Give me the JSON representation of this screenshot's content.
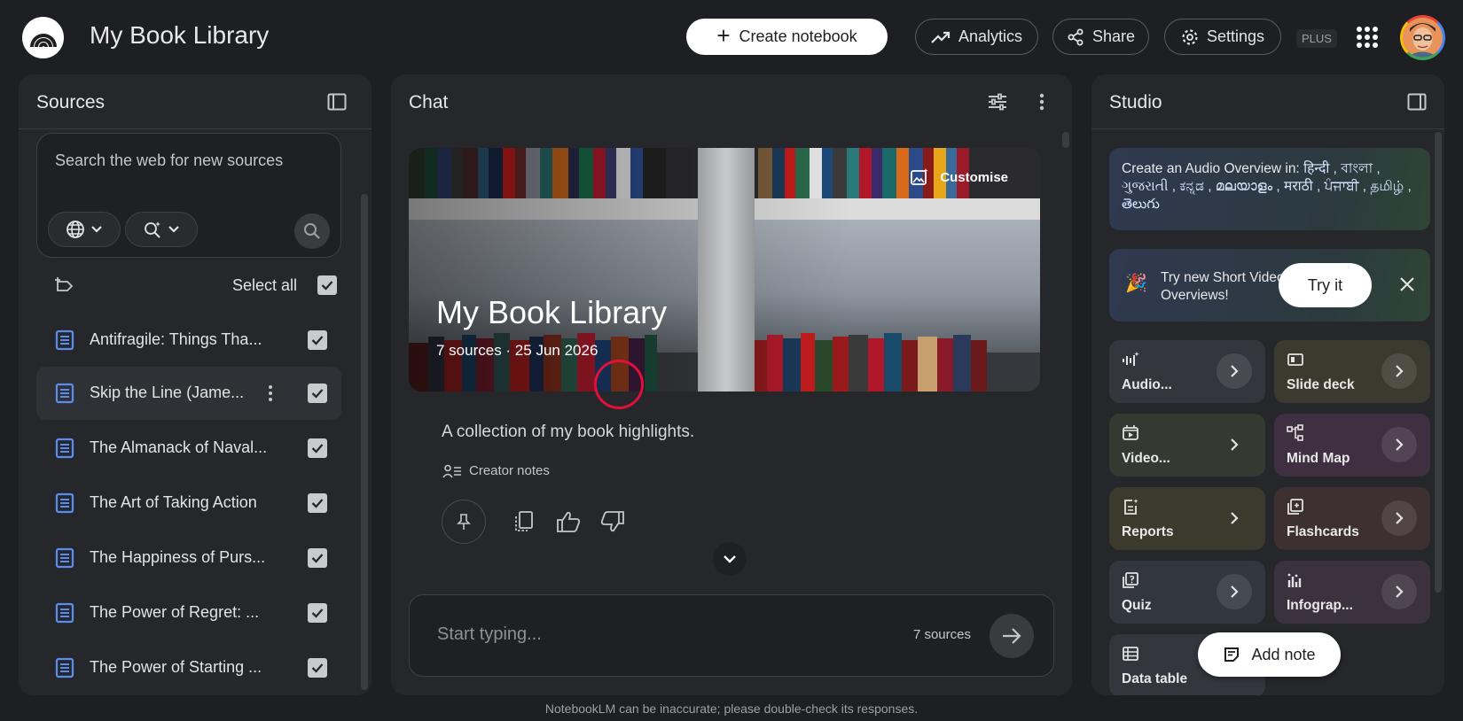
{
  "header": {
    "title": "My Book Library",
    "create_label": "Create notebook",
    "analytics_label": "Analytics",
    "share_label": "Share",
    "settings_label": "Settings",
    "plan_badge": "PLUS"
  },
  "sources": {
    "title": "Sources",
    "search_placeholder": "Search the web for new sources",
    "select_all_label": "Select all",
    "items": [
      {
        "label": "Antifragile: Things Tha...",
        "checked": true
      },
      {
        "label": "Skip the Line (Jame...",
        "checked": true
      },
      {
        "label": "The Almanack of Naval...",
        "checked": true
      },
      {
        "label": "The Art of Taking Action",
        "checked": true
      },
      {
        "label": "The Happiness of Purs...",
        "checked": true
      },
      {
        "label": "The Power of Regret: ...",
        "checked": true
      },
      {
        "label": "The Power of Starting ...",
        "checked": true
      }
    ]
  },
  "chat": {
    "title": "Chat",
    "hero_title": "My Book Library",
    "hero_meta": "7 sources · 25 Jun 2026",
    "customise_label": "Customise",
    "description": "A collection of my book highlights.",
    "creator_notes_label": "Creator notes",
    "input_placeholder": "Start typing...",
    "source_count": "7 sources"
  },
  "studio": {
    "title": "Studio",
    "audio_overview_prefix": "Create an Audio Overview in:",
    "audio_overview_languages": "हिन्दी , বাংলা , ગુજરાતી , ಕನ್ನಡ , മലയാളം , मराठी , ਪੰਜਾਬੀ , தமிழ் , తెలుగు",
    "promo_text": "Try new Short Video Overviews!",
    "try_label": "Try it",
    "tiles": [
      {
        "label": "Audio...",
        "icon": "audio-waveform-icon"
      },
      {
        "label": "Slide deck",
        "icon": "slides-icon"
      },
      {
        "label": "Video...",
        "icon": "video-icon"
      },
      {
        "label": "Mind Map",
        "icon": "mind-map-icon"
      },
      {
        "label": "Reports",
        "icon": "reports-icon"
      },
      {
        "label": "Flashcards",
        "icon": "flashcards-icon"
      },
      {
        "label": "Quiz",
        "icon": "quiz-icon"
      },
      {
        "label": "Infograp...",
        "icon": "infographic-icon"
      },
      {
        "label": "Data table",
        "icon": "table-icon"
      }
    ],
    "add_note_label": "Add note"
  },
  "footer": {
    "disclaimer": "NotebookLM can be inaccurate; please double-check its responses."
  },
  "colors": {
    "background": "#1e1f23",
    "panel": "#26272b",
    "source_icon": "#5b8def",
    "tile_audio": "#33363d",
    "tile_slides": "#3a3a2f",
    "tile_video": "#343a31",
    "tile_mindmap": "#3e3040",
    "tile_reports": "#3b3a2c",
    "tile_flashcards": "#3c3130",
    "tile_quiz": "#32363f",
    "tile_infographic": "#3c313e",
    "tile_table": "#33363d"
  }
}
